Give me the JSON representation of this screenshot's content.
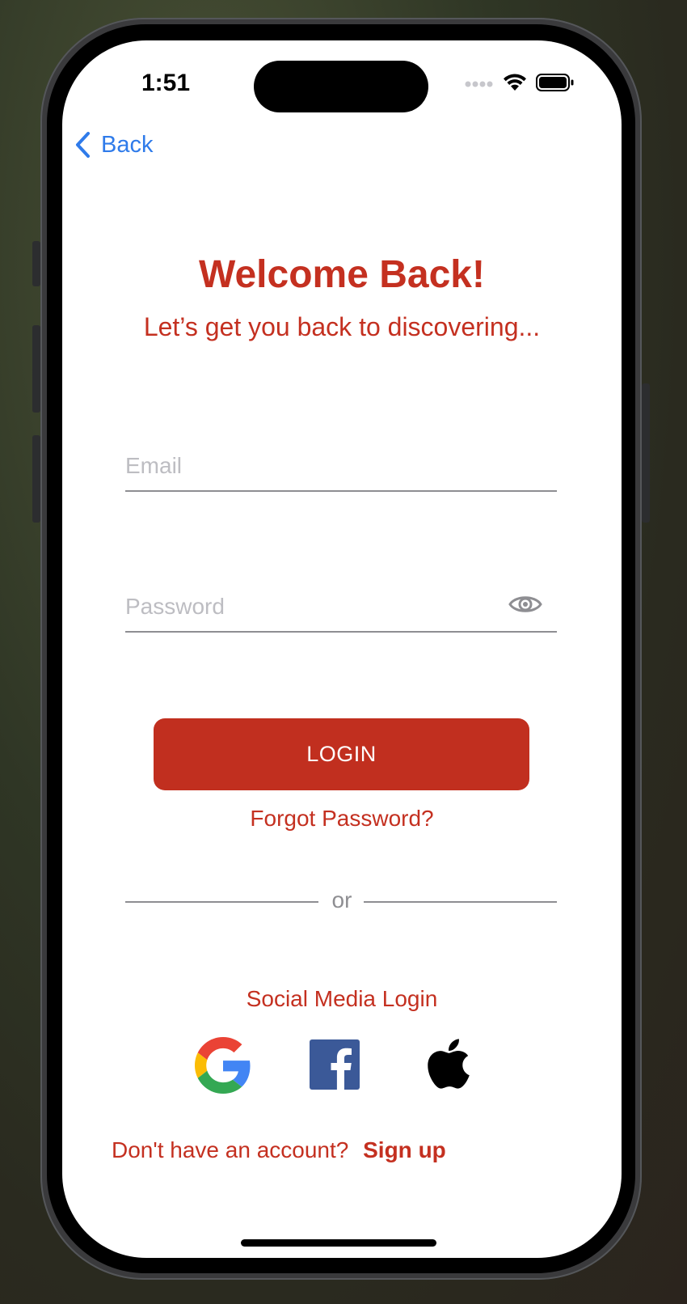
{
  "status_bar": {
    "time": "1:51",
    "icons": [
      "signal-dots-icon",
      "wifi-icon",
      "battery-icon"
    ]
  },
  "nav": {
    "back_label": "Back",
    "back_icon": "chevron-left-icon"
  },
  "header": {
    "title": "Welcome Back!",
    "subtitle": "Let’s get you back to discovering..."
  },
  "form": {
    "email": {
      "value": "",
      "placeholder": "Email"
    },
    "password": {
      "value": "",
      "placeholder": "Password",
      "toggle_icon": "eye-icon"
    },
    "login_label": "LOGIN",
    "forgot_label": "Forgot Password?"
  },
  "divider": {
    "text": "or"
  },
  "social": {
    "label": "Social Media Login",
    "providers": [
      {
        "name": "Google",
        "icon": "google-icon"
      },
      {
        "name": "Facebook",
        "icon": "facebook-icon"
      },
      {
        "name": "Apple",
        "icon": "apple-icon"
      }
    ]
  },
  "footer": {
    "prompt": "Don't have an account?",
    "signup_label": "Sign up"
  },
  "colors": {
    "brand_red": "#c12f1f",
    "link_blue": "#2f7bea",
    "muted_gray": "#8e8e92",
    "placeholder_gray": "#bdbdc2"
  }
}
